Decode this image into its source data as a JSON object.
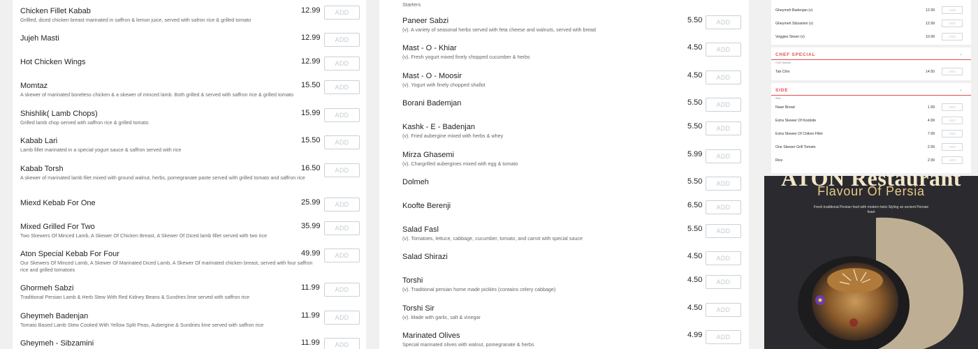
{
  "panel1": {
    "items": [
      {
        "name": "Chicken Fillet Kabab",
        "desc": "Grillled, diced chicken breast marinated in saffron & lemon juice, served with safron rice & grilled tomato",
        "price": "12.99"
      },
      {
        "name": "Jujeh Masti",
        "desc": "",
        "price": "12.99"
      },
      {
        "name": "Hot Chicken Wings",
        "desc": "",
        "price": "12.99"
      },
      {
        "name": "Momtaz",
        "desc": "A skewer of marinated boneless chicken & a skewer of minced lamb. Both grilled & served with saffron rice & grilled tomato",
        "price": "15.50"
      },
      {
        "name": "Shishlik( Lamb Chops)",
        "desc": "Grilled lamb chop served with saffron rice & grilled tomato",
        "price": "15.99"
      },
      {
        "name": "Kabab Lari",
        "desc": "Lamb fillet marinated in a special yogurt sauce & saffron served with rice",
        "price": "15.50"
      },
      {
        "name": "Kabab Torsh",
        "desc": "A skewer of marinated lamb filet mixed with ground walnut, herbs, pomegranate paste served with grilled tomato and saffron rice",
        "price": "16.50"
      },
      {
        "name": "Miexd Kebab For One",
        "desc": "",
        "price": "25.99"
      },
      {
        "name": "Mixed Grilled For Two",
        "desc": "Two Skewers Of Minced Lamb, A Skewer Of Chicken Breast, A Skewer Of Diced lamb fillet served with two rice",
        "price": "35.99"
      },
      {
        "name": "Aton Special Kebab For Four",
        "desc": "Our Skewers Of Minced Lamb, A Skewer Of Marinated Diced Lamb, A Skewer Of marinated chicken breast, served with four saffron rice and grilled tomatoes",
        "price": "49.99"
      },
      {
        "name": "Ghormeh Sabzi",
        "desc": "Traditional Persian Lamb & Herb Stew With Red Kidney Beans & Sundries lime served with saffron rice",
        "price": "11.99"
      },
      {
        "name": "Gheymeh Badenjan",
        "desc": "Tomato Based Lamb Stew Cooked With Yellow Split Peas, Aubergine & Sundries lime served with saffron rice",
        "price": "11.99"
      },
      {
        "name": "Gheymeh - Sibzamini",
        "desc": "",
        "price": "11.99"
      }
    ]
  },
  "panel2": {
    "category": "Starters",
    "items": [
      {
        "name": "Paneer Sabzi",
        "desc": "(v). A variety of seasonal herbs served with feta cheese and walnuts, served with bread",
        "price": "5.50"
      },
      {
        "name": "Mast - O - Khiar",
        "desc": "(v). Fresh yogurt mixed finely chopped cucumber & herbs",
        "price": "4.50"
      },
      {
        "name": "Mast - O - Moosir",
        "desc": "(v). Yogurt with finely chopped shallot",
        "price": "4.50"
      },
      {
        "name": "Borani Bademjan",
        "desc": "",
        "price": "5.50"
      },
      {
        "name": "Kashk - E - Badenjan",
        "desc": "(v). Fried aubergine mixed with herbs & whey",
        "price": "5.50"
      },
      {
        "name": "Mirza Ghasemi",
        "desc": "(v). Chargrilled aubergines mixed with egg & tomato",
        "price": "5.99"
      },
      {
        "name": "Dolmeh",
        "desc": "",
        "price": "5.50"
      },
      {
        "name": "Koofte Berenji",
        "desc": "",
        "price": "6.50"
      },
      {
        "name": "Salad Fasl",
        "desc": "(v). Tomatoes, lettuce, cabbage, cucumber, tomato, and carrot with special sauce",
        "price": "5.50"
      },
      {
        "name": "Salad Shirazi",
        "desc": "",
        "price": "4.50"
      },
      {
        "name": "Torshi",
        "desc": "(v). Traditional persian home made pickles (contains celery cabbage)",
        "price": "4.50"
      },
      {
        "name": "Torshi Sir",
        "desc": "(v). Made with garlic, salt & vinegar",
        "price": "4.50"
      },
      {
        "name": "Marinated Olives",
        "desc": "Special marinated olives with walnut, pomegranate & herbs",
        "price": "4.99"
      }
    ]
  },
  "add_label": "ADD",
  "panel3": {
    "top_items": [
      {
        "name": "Gheymeh Badenjan (v)",
        "price": "12.99"
      },
      {
        "name": "Gheymeh Sibzamini (v)",
        "price": "12.99"
      },
      {
        "name": "Veggies Skwer (v)",
        "price": "10.99"
      }
    ],
    "chef_special": {
      "title": "CHEF SPECIAL",
      "subtitle": "Chef Special",
      "items": [
        {
          "name": "Tah Chin",
          "price": "14.50"
        }
      ]
    },
    "side": {
      "title": "SIDE",
      "subtitle": "Side",
      "items": [
        {
          "name": "Naan Bread",
          "price": "1.99"
        },
        {
          "name": "Extra Skewer Of Koobide",
          "price": "4.99"
        },
        {
          "name": "Extra Skewer Of Chiken Fillet",
          "price": "7.99"
        },
        {
          "name": "One Skewer Grill Tomato",
          "price": "2.99"
        },
        {
          "name": "Rice",
          "price": "2.99"
        }
      ]
    },
    "add_label": "ADD"
  },
  "promo": {
    "title": "ATON Restaurant",
    "subtitle": "Flavour Of Persia",
    "tagline": "Fresh traditional Persian food with modern twist Styling an ancient Persian feast"
  },
  "colors": {
    "accent": "#e64a4a",
    "promo_bg": "#2b2b2f",
    "gold": "#e8c987"
  }
}
